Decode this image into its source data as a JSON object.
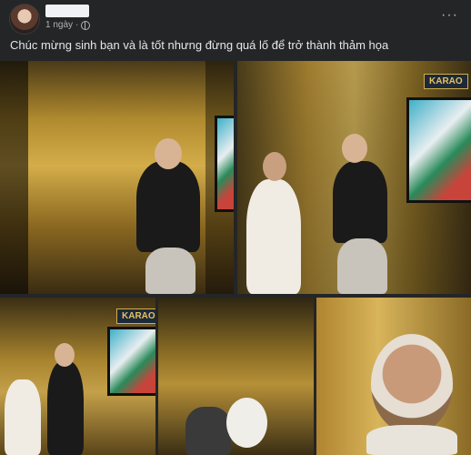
{
  "post": {
    "time": "1 ngày",
    "dot": "·",
    "menu": "···",
    "text": "Chúc mừng sinh bạn và là tốt nhưng đừng quá lố để trở thành thảm họa"
  },
  "photos": {
    "sign_text": "KARAO",
    "sign_text_full": "KARAOKE"
  },
  "colors": {
    "background": "#242526",
    "text": "#e4e6eb",
    "secondary": "#b0b3b8"
  },
  "icons": [
    "avatar",
    "globe-icon",
    "more-options-icon"
  ]
}
